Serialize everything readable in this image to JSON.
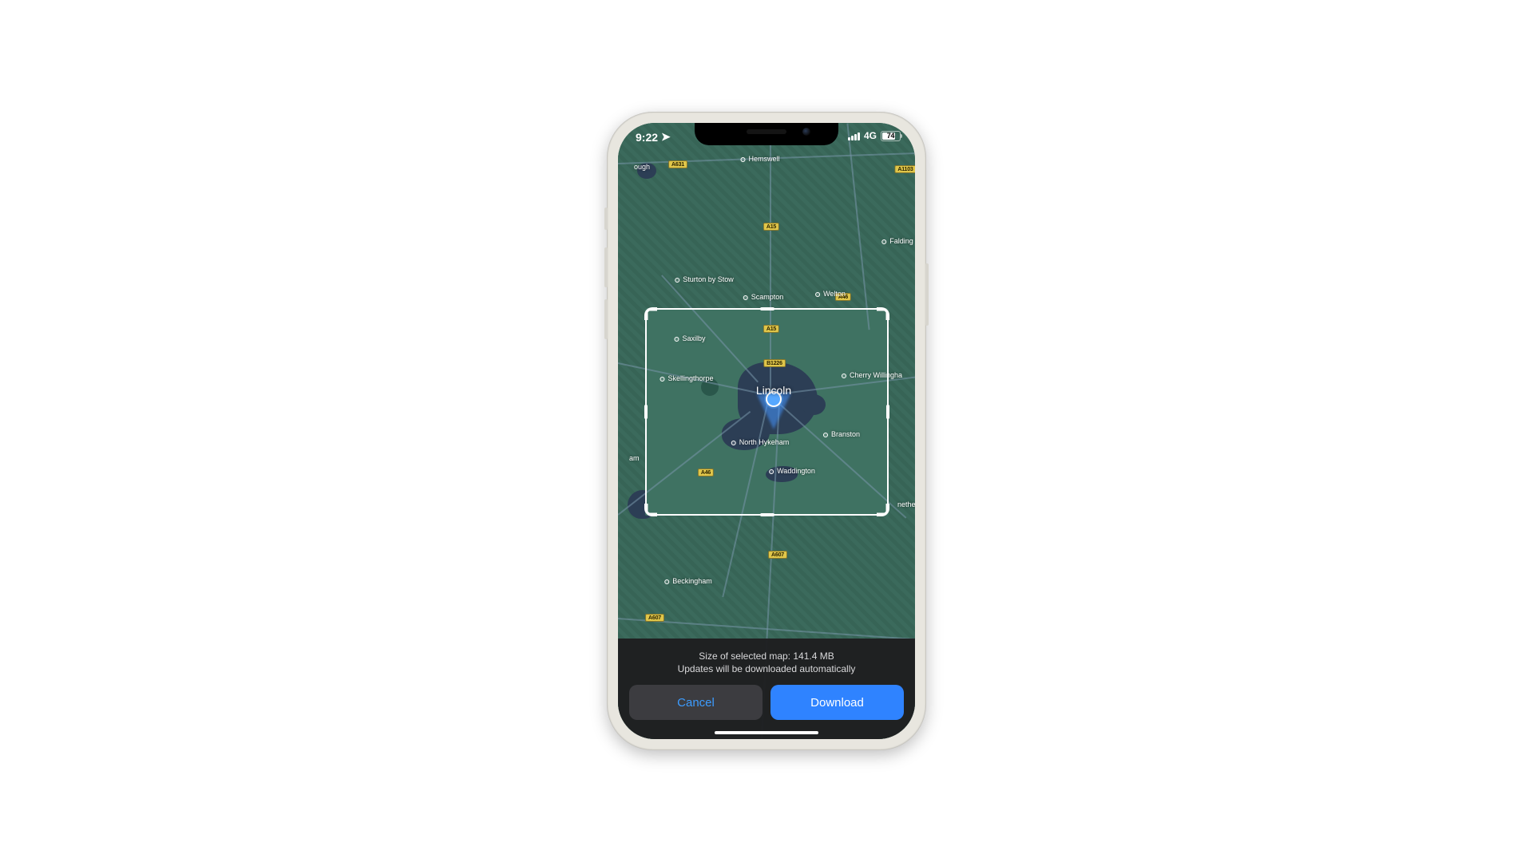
{
  "status_bar": {
    "time": "9:22",
    "location_glyph": "➤",
    "network": "4G",
    "battery_pct": "74"
  },
  "map": {
    "city_center": "Lincoln",
    "road_shields": {
      "a631": "A631",
      "a15_n": "A15",
      "a15_s": "A15",
      "b1226": "B1226",
      "a46_w": "A46",
      "a46_e": "A46",
      "a607_1": "A607",
      "a607_2": "A607",
      "a1103": "A1103"
    },
    "towns": {
      "hemswell": "Hemswell",
      "falding": "Falding",
      "sturton": "Sturton by Stow",
      "scampton": "Scampton",
      "welton": "Welton",
      "saxilby": "Saxilby",
      "skellingthorpe": "Skellingthorpe",
      "cherry": "Cherry Willingha",
      "branston": "Branston",
      "north_hykeham": "North Hykeham",
      "waddington": "Waddington",
      "beckingham": "Beckingham",
      "nether": "nether",
      "ough": "ough",
      "am": "am"
    }
  },
  "sheet": {
    "size_line": "Size of selected map: 141.4 MB",
    "updates_line": "Updates will be downloaded automatically",
    "cancel_label": "Cancel",
    "download_label": "Download"
  },
  "colors": {
    "accent_blue": "#2f83ff",
    "map_base": "#3b6a5c",
    "sheet_bg": "#1e1e20"
  }
}
